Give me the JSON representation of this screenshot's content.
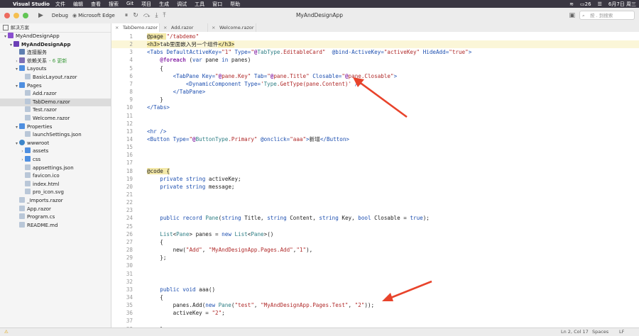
{
  "menubar": {
    "app": "Visual Studio",
    "menus": [
      "文件",
      "编辑",
      "查看",
      "搜索",
      "Git",
      "项目",
      "生成",
      "调试",
      "工具",
      "窗口",
      "帮助"
    ],
    "battery": "26",
    "datetime": "6月7日 周三"
  },
  "toolbar": {
    "config": "Debug",
    "target": "Microsoft Edge",
    "title": "MyAndDesignApp",
    "search_placeholder": "按 . 到搜索"
  },
  "solution_pad": {
    "header": "解决方案",
    "items": [
      {
        "label": "MyAndDesignApp",
        "icon": "solution-icon",
        "depth": 0,
        "chevron": "▾"
      },
      {
        "label": "MyAndDesignApp",
        "icon": "project-icon",
        "depth": 1,
        "chevron": "▾",
        "bold": true
      },
      {
        "label": "连接服务",
        "icon": "connected-services-icon",
        "depth": 2,
        "chevron": ""
      },
      {
        "label": "依赖关系",
        "badge": "- 6 更新",
        "icon": "dependencies-icon",
        "depth": 2,
        "chevron": "›"
      },
      {
        "label": "Layouts",
        "icon": "folder-icon",
        "depth": 2,
        "chevron": "▾"
      },
      {
        "label": "BasicLayout.razor",
        "icon": "file-icon",
        "depth": 3,
        "chevron": ""
      },
      {
        "label": "Pages",
        "icon": "folder-icon",
        "depth": 2,
        "chevron": "▾"
      },
      {
        "label": "Add.razor",
        "icon": "file-icon",
        "depth": 3,
        "chevron": ""
      },
      {
        "label": "TabDemo.razor",
        "icon": "file-icon",
        "depth": 3,
        "chevron": "",
        "selected": true
      },
      {
        "label": "Test.razor",
        "icon": "file-icon",
        "depth": 3,
        "chevron": ""
      },
      {
        "label": "Welcome.razor",
        "icon": "file-icon",
        "depth": 3,
        "chevron": ""
      },
      {
        "label": "Properties",
        "icon": "folder-icon",
        "depth": 2,
        "chevron": "▾"
      },
      {
        "label": "launchSettings.json",
        "icon": "file-icon",
        "depth": 3,
        "chevron": ""
      },
      {
        "label": "wwwroot",
        "icon": "wwwroot-icon",
        "depth": 2,
        "chevron": "▾"
      },
      {
        "label": "assets",
        "icon": "folder-icon",
        "depth": 3,
        "chevron": "›"
      },
      {
        "label": "css",
        "icon": "folder-icon",
        "depth": 3,
        "chevron": "›"
      },
      {
        "label": "appsettings.json",
        "icon": "file-icon",
        "depth": 3,
        "chevron": ""
      },
      {
        "label": "favicon.ico",
        "icon": "file-icon",
        "depth": 3,
        "chevron": ""
      },
      {
        "label": "index.html",
        "icon": "file-icon",
        "depth": 3,
        "chevron": ""
      },
      {
        "label": "pro_icon.svg",
        "icon": "file-icon",
        "depth": 3,
        "chevron": ""
      },
      {
        "label": "_Imports.razor",
        "icon": "file-icon",
        "depth": 2,
        "chevron": ""
      },
      {
        "label": "App.razor",
        "icon": "file-icon",
        "depth": 2,
        "chevron": ""
      },
      {
        "label": "Program.cs",
        "icon": "file-icon",
        "depth": 2,
        "chevron": ""
      },
      {
        "label": "README.md",
        "icon": "file-icon",
        "depth": 2,
        "chevron": ""
      }
    ]
  },
  "editor": {
    "tabs": [
      {
        "label": "TabDemo.razor",
        "active": true
      },
      {
        "label": "Add.razor",
        "active": false
      },
      {
        "label": "Welcome.razor",
        "active": false
      }
    ],
    "current_line": 2,
    "lines": [
      [
        [
          "@page ",
          "h"
        ],
        [
          "\"/tabdemo\"",
          "s"
        ]
      ],
      [
        [
          "<h3>",
          "h"
        ],
        [
          "tab里面嵌入另一个组件",
          ""
        ],
        [
          "</h3>",
          "h"
        ]
      ],
      [
        [
          "<Tabs ",
          "b"
        ],
        [
          "DefaultActiveKey=",
          "b"
        ],
        [
          "\"1\" ",
          "s"
        ],
        [
          "Type=",
          "b"
        ],
        [
          "\"",
          "s"
        ],
        [
          "@",
          "k"
        ],
        [
          "TabType",
          "t"
        ],
        [
          ".EditableCard\"  ",
          "s"
        ],
        [
          "@bind-ActiveKey=",
          "b"
        ],
        [
          "\"activeKey\" ",
          "s"
        ],
        [
          "HideAdd=",
          "b"
        ],
        [
          "\"true\"",
          "s"
        ],
        [
          ">",
          "b"
        ]
      ],
      [
        [
          "    @foreach ",
          "k"
        ],
        [
          "(",
          ""
        ],
        [
          "var ",
          "b"
        ],
        [
          "pane ",
          ""
        ],
        [
          "in ",
          "b"
        ],
        [
          "panes)",
          ""
        ]
      ],
      [
        [
          "    {",
          ""
        ]
      ],
      [
        [
          "        <TabPane ",
          "b"
        ],
        [
          "Key=",
          "b"
        ],
        [
          "\"",
          "s"
        ],
        [
          "@",
          "k"
        ],
        [
          "pane.Key\" ",
          "s"
        ],
        [
          "Tab=",
          "b"
        ],
        [
          "\"",
          "s"
        ],
        [
          "@",
          "k"
        ],
        [
          "pane.Title\" ",
          "s"
        ],
        [
          "Closable=",
          "b"
        ],
        [
          "\"",
          "s"
        ],
        [
          "@",
          "k"
        ],
        [
          "pane.Closable\"",
          "s"
        ],
        [
          ">",
          "b"
        ]
      ],
      [
        [
          "            <DynamicComponent ",
          "b"
        ],
        [
          "Type=",
          "b"
        ],
        [
          "'",
          "s"
        ],
        [
          "Type",
          "t"
        ],
        [
          ".GetType(pane.Content)' ",
          "s"
        ],
        [
          "/>",
          "b"
        ]
      ],
      [
        [
          "        </TabPane>",
          "b"
        ]
      ],
      [
        [
          "    }",
          ""
        ]
      ],
      [
        [
          "</Tabs>",
          "b"
        ]
      ],
      [
        [
          "",
          ""
        ]
      ],
      [
        [
          "",
          ""
        ]
      ],
      [
        [
          "<hr />",
          "b"
        ]
      ],
      [
        [
          "<Button ",
          "b"
        ],
        [
          "Type=",
          "b"
        ],
        [
          "\"",
          "s"
        ],
        [
          "@",
          "k"
        ],
        [
          "ButtonType",
          "t"
        ],
        [
          ".Primary\" ",
          "s"
        ],
        [
          "@onclick=",
          "b"
        ],
        [
          "\"aaa\"",
          "s"
        ],
        [
          ">",
          "b"
        ],
        [
          "新增",
          ""
        ],
        [
          "</Button>",
          "b"
        ]
      ],
      [
        [
          "",
          ""
        ]
      ],
      [
        [
          "",
          ""
        ]
      ],
      [
        [
          "",
          ""
        ]
      ],
      [
        [
          "@code ",
          "h"
        ],
        [
          "{",
          "h"
        ]
      ],
      [
        [
          "    private ",
          "b"
        ],
        [
          "string ",
          "b"
        ],
        [
          "activeKey;",
          ""
        ]
      ],
      [
        [
          "    private ",
          "b"
        ],
        [
          "string ",
          "b"
        ],
        [
          "message;",
          ""
        ]
      ],
      [
        [
          "",
          ""
        ]
      ],
      [
        [
          "",
          ""
        ]
      ],
      [
        [
          "",
          ""
        ]
      ],
      [
        [
          "    public ",
          "b"
        ],
        [
          "record ",
          "b"
        ],
        [
          "Pane",
          "t"
        ],
        [
          "(",
          ""
        ],
        [
          "string ",
          "b"
        ],
        [
          "Title, ",
          ""
        ],
        [
          "string ",
          "b"
        ],
        [
          "Content, ",
          ""
        ],
        [
          "string ",
          "b"
        ],
        [
          "Key, ",
          ""
        ],
        [
          "bool ",
          "b"
        ],
        [
          "Closable = ",
          ""
        ],
        [
          "true",
          "b"
        ],
        [
          ");",
          ""
        ]
      ],
      [
        [
          "",
          ""
        ]
      ],
      [
        [
          "    List",
          "t"
        ],
        [
          "<",
          ""
        ],
        [
          "Pane",
          "t"
        ],
        [
          "> panes = ",
          ""
        ],
        [
          "new ",
          "b"
        ],
        [
          "List",
          "t"
        ],
        [
          "<",
          ""
        ],
        [
          "Pane",
          "t"
        ],
        [
          ">()",
          ""
        ]
      ],
      [
        [
          "    {",
          ""
        ]
      ],
      [
        [
          "        new(",
          ""
        ],
        [
          "\"Add\"",
          "s"
        ],
        [
          ", ",
          ""
        ],
        [
          "\"MyAndDesignApp.Pages.Add\"",
          "s"
        ],
        [
          ",",
          ""
        ],
        [
          "\"1\"",
          "s"
        ],
        [
          "),",
          ""
        ]
      ],
      [
        [
          "    };",
          ""
        ]
      ],
      [
        [
          "",
          ""
        ]
      ],
      [
        [
          "",
          ""
        ]
      ],
      [
        [
          "",
          ""
        ]
      ],
      [
        [
          "    public ",
          "b"
        ],
        [
          "void ",
          "b"
        ],
        [
          "aaa()",
          ""
        ]
      ],
      [
        [
          "    {",
          ""
        ]
      ],
      [
        [
          "        panes.Add(",
          ""
        ],
        [
          "new ",
          "b"
        ],
        [
          "Pane",
          "t"
        ],
        [
          "(",
          ""
        ],
        [
          "\"test\"",
          "s"
        ],
        [
          ", ",
          ""
        ],
        [
          "\"MyAndDesignApp.Pages.Test\"",
          "s"
        ],
        [
          ", ",
          ""
        ],
        [
          "\"2\"",
          "s"
        ],
        [
          "));",
          ""
        ]
      ],
      [
        [
          "        activeKey = ",
          ""
        ],
        [
          "\"2\"",
          "s"
        ],
        [
          ";",
          ""
        ]
      ],
      [
        [
          "",
          ""
        ]
      ],
      [
        [
          "    }",
          ""
        ]
      ]
    ]
  },
  "status": {
    "position": "Ln 2, Col 17",
    "indent": "Spaces",
    "line_ending": "LF"
  },
  "colors": {
    "menubar_bg": "#3a3742",
    "selection_bg": "#dcdcdc",
    "arrow": "#e8432b",
    "keyword": "#8b2ca8",
    "markup": "#1d4fb0",
    "string": "#b02a2a"
  }
}
